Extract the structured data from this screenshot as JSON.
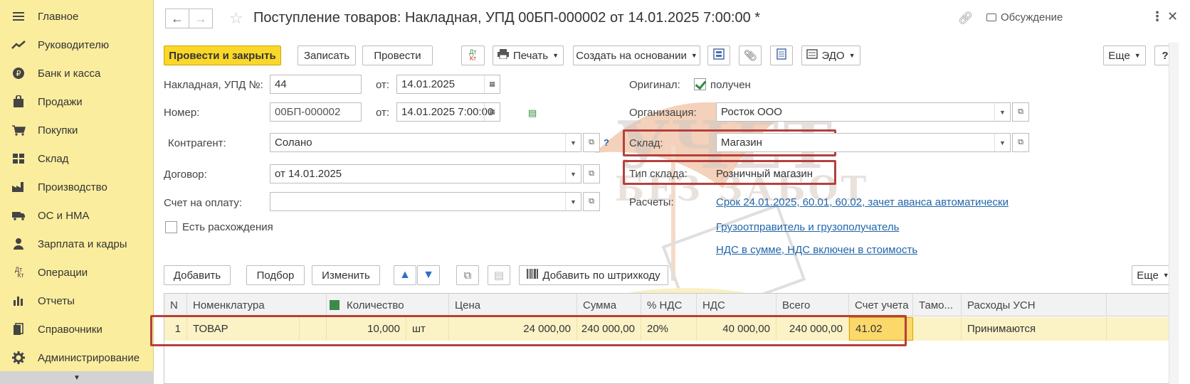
{
  "sidebar": {
    "items": [
      {
        "label": "Главное",
        "icon": "menu-icon"
      },
      {
        "label": "Руководителю",
        "icon": "chart-line-icon"
      },
      {
        "label": "Банк и касса",
        "icon": "ruble-icon"
      },
      {
        "label": "Продажи",
        "icon": "bag-icon"
      },
      {
        "label": "Покупки",
        "icon": "cart-icon"
      },
      {
        "label": "Склад",
        "icon": "warehouse-icon"
      },
      {
        "label": "Производство",
        "icon": "factory-icon"
      },
      {
        "label": "ОС и НМА",
        "icon": "truck-icon"
      },
      {
        "label": "Зарплата и кадры",
        "icon": "person-icon"
      },
      {
        "label": "Операции",
        "icon": "dt-kt-icon"
      },
      {
        "label": "Отчеты",
        "icon": "bar-chart-icon"
      },
      {
        "label": "Справочники",
        "icon": "books-icon"
      },
      {
        "label": "Администрирование",
        "icon": "gear-icon"
      }
    ]
  },
  "header": {
    "title": "Поступление товаров: Накладная, УПД 00БП-000002 от 14.01.2025 7:00:00 *",
    "discussion": "Обсуждение"
  },
  "toolbar": {
    "post_close": "Провести и закрыть",
    "save": "Записать",
    "post": "Провести",
    "dtkt_top": "Дт",
    "dtkt_bottom": "Кт",
    "print": "Печать",
    "create_based": "Создать на основании",
    "edo": "ЭДО",
    "more": "Еще",
    "help": "?"
  },
  "form": {
    "invoice_label": "Накладная, УПД №:",
    "invoice_value": "44",
    "from_label": "от:",
    "invoice_date": "14.01.2025",
    "number_label": "Номер:",
    "number_value": "00БП-000002",
    "number_datetime": "14.01.2025  7:00:00",
    "counterparty_label": "Контрагент:",
    "counterparty_value": "Солано",
    "help_mark": "?",
    "contract_label": "Договор:",
    "contract_value": "от 14.01.2025",
    "payment_invoice_label": "Счет на оплату:",
    "payment_invoice_value": "",
    "discrepancy_label": "Есть расхождения",
    "original_label": "Оригинал:",
    "original_value": "получен",
    "org_label": "Организация:",
    "org_value": "Росток ООО",
    "warehouse_label": "Склад:",
    "warehouse_value": "Магазин",
    "warehouse_type_label": "Тип склада:",
    "warehouse_type_value": "Розничный магазин",
    "settlements_label": "Расчеты:",
    "settlements_link": "Срок 24.01.2025, 60.01, 60.02, зачет аванса автоматически",
    "shipper_link": "Грузоотправитель и грузополучатель",
    "vat_link": "НДС в сумме, НДС включен в стоимость"
  },
  "table_toolbar": {
    "add": "Добавить",
    "select": "Подбор",
    "edit": "Изменить",
    "barcode": "Добавить по штрихкоду",
    "more": "Еще"
  },
  "table": {
    "columns": [
      "N",
      "Номенклатура",
      "Количество",
      "Цена",
      "Сумма",
      "% НДС",
      "НДС",
      "Всего",
      "Счет учета",
      "Тамо...",
      "Расходы УСН"
    ],
    "rows": [
      {
        "n": "1",
        "item": "ТОВАР",
        "qty": "10,000",
        "unit": "шт",
        "price": "24 000,00",
        "sum": "240 000,00",
        "vat_rate": "20%",
        "vat": "40 000,00",
        "total": "240 000,00",
        "account": "41.02",
        "customs": "",
        "usn": "Принимаются"
      }
    ]
  },
  "watermark": {
    "line1": "УЧЕТ",
    "line2": "БЕЗ ЗАБОТ"
  },
  "colors": {
    "sidebar_bg": "#fbed9e",
    "primary_button": "#fbd72a",
    "selected_row": "#fbf3c6",
    "highlight_border": "#b5403c",
    "link": "#2266aa"
  }
}
